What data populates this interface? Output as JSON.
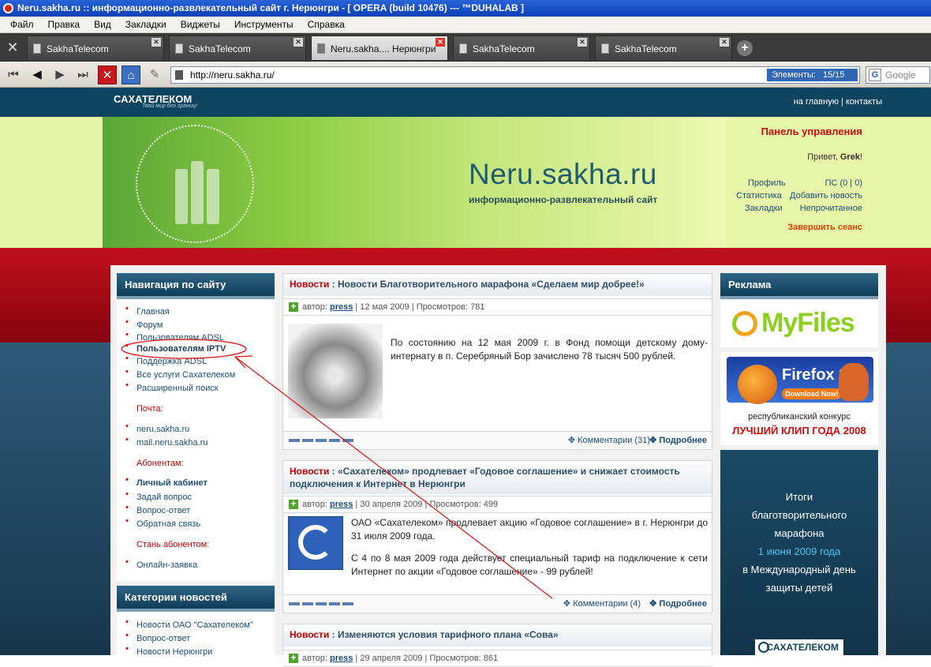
{
  "window": {
    "title": "Neru.sakha.ru :: информационно-развлекательный сайт г. Нерюнгри - [ OPERA (build 10476) --- ™DUHALAB ]"
  },
  "menu": [
    "Файл",
    "Правка",
    "Вид",
    "Закладки",
    "Виджеты",
    "Инструменты",
    "Справка"
  ],
  "tabs": [
    {
      "label": "SakhaTelecom"
    },
    {
      "label": "SakhaTelecom"
    },
    {
      "label": "Neru.sakha.... Нерюнгри",
      "active": true
    },
    {
      "label": "SakhaTelecom"
    },
    {
      "label": "SakhaTelecom"
    }
  ],
  "address": {
    "url": "http://neru.sakha.ru/",
    "elements_label": "Элементы:",
    "elements_count": "15/15"
  },
  "search": {
    "placeholder": "Google"
  },
  "site": {
    "logo": "САХАТЕЛЕКОМ",
    "logo_slogan": "Твой мир без границ!",
    "top_links": {
      "home": "на главную",
      "sep": "|",
      "contacts": "контакты"
    },
    "name": "Neru.sakha.ru",
    "subtitle": "информационно-развлекательный сайт"
  },
  "panel": {
    "title": "Панель управления",
    "greeting": "Привет,",
    "user": "Grek",
    "excl": "!",
    "links": {
      "profile": "Профиль",
      "pm": "ПС (0 | 0)",
      "stats": "Статистика",
      "add_news": "Добавить новость",
      "bookmarks": "Закладки",
      "unread": "Непрочитанное"
    },
    "logout": "Завершить сеанс"
  },
  "nav": {
    "title": "Навигация по сайту",
    "items": [
      "Главная",
      "Форум",
      "Пользователям ADSL",
      "Пользователям IPTV",
      "Поддержка ADSL",
      "Все услуги Сахателеком",
      "Расширенный поиск"
    ],
    "mail_header": "Почта:",
    "mail": [
      "neru.sakha.ru",
      "mail.neru.sakha.ru"
    ],
    "subs_header": "Абонентам:",
    "subs": [
      "Личный кабинет",
      "Задай вопрос",
      "Вопрос-ответ",
      "Обратная связь"
    ],
    "become_header": "Стань абонентом:",
    "become": [
      "Онлайн-заявка"
    ]
  },
  "categories": {
    "title": "Категории новостей",
    "items": [
      "Новости ОАО \"Сахателеком\"",
      "Вопрос-ответ",
      "Новости Нерюнгри"
    ]
  },
  "news": [
    {
      "tag": "Новости",
      "title": ": Новости Благотворительного марафона «Сделаем мир добрее!»",
      "author_label": "автор:",
      "author": "press",
      "date": "| 12 мая 2009 | Просмотров: 781",
      "text": "По состоянию на 12 мая 2009 г. в Фонд помощи детскому дому-интернату в п. Серебряный Бор зачислено 78 тысяч 500 рублей.",
      "comments": "Комментарии (31)",
      "more": "Подробнее"
    },
    {
      "tag": "Новости",
      "title": ": «Сахателеком» продлевает «Годовое соглашение» и снижает стоимость подключения к Интернет в Нерюнгри",
      "author_label": "автор:",
      "author": "press",
      "date": "| 30 апреля 2009 | Просмотров: 499",
      "text1": "ОАО «Сахателеком» продлевает акцию «Годовое соглашение» в г. Нерюнгри до 31 июля 2009 года.",
      "text2": "С 4 по 8 мая 2009 года действует специальный тариф на подключение к сети Интернет по акции «Годовое соглашение» - 99 рублей!",
      "comments": "Комментарии (4)",
      "more": "Подробнее"
    },
    {
      "tag": "Новости",
      "title": ": Изменяются условия тарифного плана «Сова»",
      "author_label": "автор:",
      "author": "press",
      "date": "| 29 апреля 2009 | Просмотров: 861"
    }
  ],
  "ads": {
    "title": "Реклама",
    "myfiles": "MyFiles",
    "firefox_name": "Firefox 3",
    "firefox_dl": "Download Now!",
    "contest_line1": "республиканский конкурс",
    "contest_line2": "ЛУЧШИЙ КЛИП ГОДА 2008",
    "itogi": [
      "Итоги",
      "благотворительного",
      "марафона"
    ],
    "itogi_date": "1 июня 2009 года",
    "itogi_tail": [
      "в Международный день",
      "защиты детей"
    ],
    "bottom_logo": "САХАТЕЛЕКОМ"
  },
  "colors": {
    "accent_red": "#c60e0e",
    "header_blue": "#0f445f",
    "link": "#1d4e7b"
  }
}
